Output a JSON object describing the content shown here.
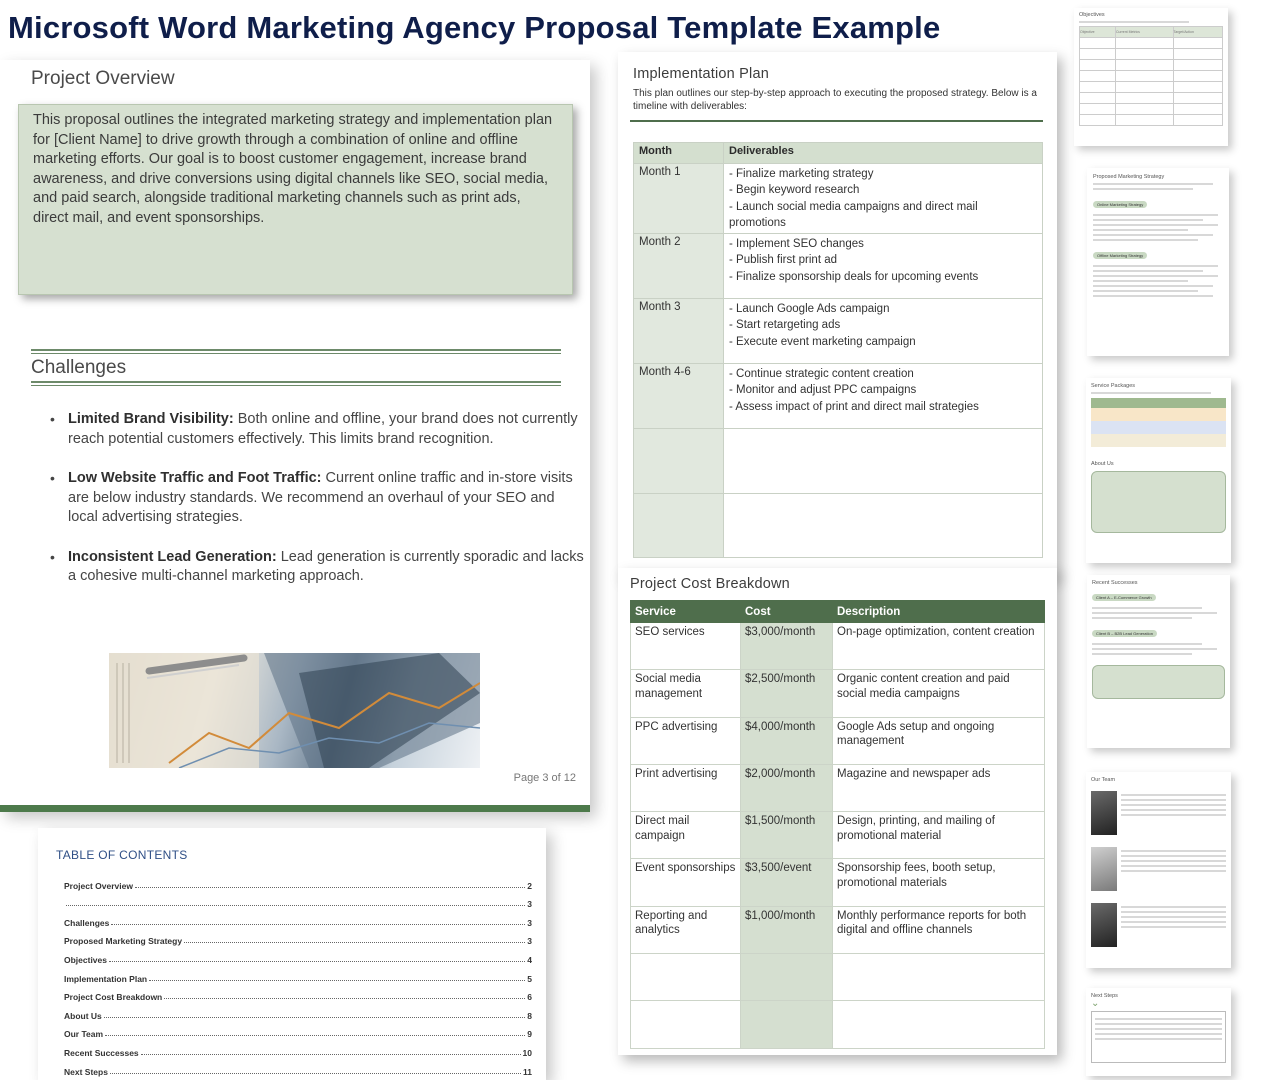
{
  "title": "Microsoft Word Marketing Agency Proposal Template Example",
  "overview_page": {
    "overview_heading": "Project Overview",
    "overview_text": "This proposal outlines the integrated marketing strategy and implementation plan for [Client Name] to drive growth through a combination of online and offline marketing efforts.  Our goal is to boost customer engagement, increase brand awareness, and drive conversions using digital channels like SEO, social media, and paid search, alongside traditional marketing channels such as print ads, direct mail, and event sponsorships.",
    "challenges_heading": "Challenges",
    "challenges": [
      {
        "label": "Limited Brand Visibility:",
        "text": " Both online and offline, your brand does not currently reach potential customers effectively. This limits brand recognition."
      },
      {
        "label": "Low Website Traffic and Foot Traffic:",
        "text": " Current online traffic and in-store visits are below industry standards. We recommend an overhaul of your SEO and local advertising strategies."
      },
      {
        "label": "Inconsistent Lead Generation:",
        "text": " Lead generation is currently sporadic and lacks a cohesive multi-channel marketing approach."
      }
    ],
    "page_number": "Page 3 of 12"
  },
  "toc": {
    "title": "TABLE OF CONTENTS",
    "entries": [
      {
        "label": "Project Overview",
        "page": "2"
      },
      {
        "label": "",
        "page": "3"
      },
      {
        "label": "Challenges",
        "page": "3"
      },
      {
        "label": "Proposed Marketing Strategy",
        "page": "3"
      },
      {
        "label": "Objectives",
        "page": "4"
      },
      {
        "label": "Implementation Plan",
        "page": "5"
      },
      {
        "label": "Project Cost Breakdown",
        "page": "6"
      },
      {
        "label": "About Us",
        "page": "8"
      },
      {
        "label": "Our Team",
        "page": "9"
      },
      {
        "label": "Recent Successes",
        "page": "10"
      },
      {
        "label": "Next Steps",
        "page": "11"
      }
    ]
  },
  "implementation": {
    "heading": "Implementation Plan",
    "intro": "This plan outlines our step-by-step approach to executing the proposed strategy. Below is a timeline with deliverables:",
    "columns": [
      "Month",
      "Deliverables"
    ],
    "rows": [
      {
        "month": "Month 1",
        "items": [
          "- Finalize marketing strategy",
          "- Begin keyword research",
          "- Launch social media campaigns and direct mail promotions"
        ]
      },
      {
        "month": "Month 2",
        "items": [
          "- Implement SEO changes",
          "- Publish first print ad",
          "- Finalize sponsorship deals for upcoming events"
        ]
      },
      {
        "month": "Month 3",
        "items": [
          "- Launch Google Ads campaign",
          "- Start retargeting ads",
          "- Execute event marketing campaign"
        ]
      },
      {
        "month": "Month 4-6",
        "items": [
          "- Continue strategic content creation",
          "- Monitor and adjust PPC campaigns",
          "- Assess impact of print and direct mail strategies"
        ]
      },
      {
        "month": "",
        "items": []
      },
      {
        "month": "",
        "items": []
      }
    ]
  },
  "cost": {
    "heading": "Project Cost Breakdown",
    "columns": [
      "Service",
      "Cost",
      "Description"
    ],
    "rows": [
      {
        "service": "SEO services",
        "cost": "$3,000/month",
        "desc": "On-page optimization, content creation"
      },
      {
        "service": "Social media management",
        "cost": "$2,500/month",
        "desc": "Organic content creation and paid social media campaigns"
      },
      {
        "service": "PPC advertising",
        "cost": "$4,000/month",
        "desc": "Google Ads setup and ongoing management"
      },
      {
        "service": "Print advertising",
        "cost": "$2,000/month",
        "desc": "Magazine and newspaper ads"
      },
      {
        "service": "Direct mail campaign",
        "cost": "$1,500/month",
        "desc": "Design, printing, and mailing of promotional material"
      },
      {
        "service": "Event sponsorships",
        "cost": "$3,500/event",
        "desc": "Sponsorship fees, booth setup, promotional materials"
      },
      {
        "service": "Reporting and analytics",
        "cost": "$1,000/month",
        "desc": "Monthly performance reports for both digital and offline channels"
      },
      {
        "service": "",
        "cost": "",
        "desc": ""
      },
      {
        "service": "",
        "cost": "",
        "desc": ""
      }
    ]
  },
  "thumbnails": {
    "objectives": "Objectives",
    "objectives_cols": [
      "Objective",
      "Current Metrics",
      "Target/Action"
    ],
    "strategy": "Proposed Marketing Strategy",
    "online_pill": "Online Marketing Strategy",
    "offline_pill": "Offline Marketing Strategy",
    "packages": "Service Packages",
    "about": "About Us",
    "successes": "Recent Successes",
    "success_1": "Client A – E-Commerce Growth",
    "success_2": "Client B – B2B Lead Generation",
    "team": "Our Team",
    "next_steps": "Next Steps"
  }
}
